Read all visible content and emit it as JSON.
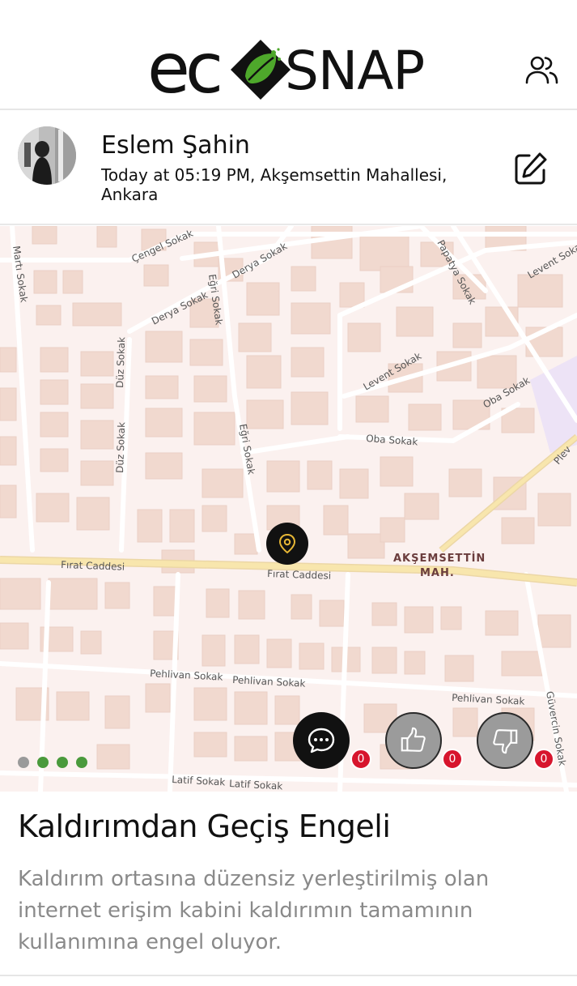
{
  "app": {
    "logo_left": "ec",
    "logo_right": "SNAP"
  },
  "header": {
    "people_icon": "users-icon"
  },
  "post": {
    "author": "Eslem Şahin",
    "meta": "Today at 05:19 PM, Akşemsettin Mahallesi, Ankara",
    "edit_icon": "edit-icon",
    "title": "Kaldırımdan Geçiş Engeli",
    "description": "Kaldırım ortasına düzensiz yerleştirilmiş olan internet erişim kabini kaldırımın tamamının kullanımına engel oluyor."
  },
  "map": {
    "streets": [
      "Çengel Sokak",
      "Derya Sokak",
      "Derya Sokak",
      "Eğri Sokak",
      "Papatya Sokak",
      "Levent Sokak",
      "Martı Sokak",
      "Düz Sokak",
      "Düz Sokak",
      "Eğri Sokak",
      "Levent Sokak",
      "Oba Sokak",
      "Oba Sokak",
      "Fırat Caddesi",
      "Fırat Caddesi",
      "Pehlivan Sokak",
      "Pehlivan Sokak",
      "Pehlivan Sokak",
      "Güvercin Sokak",
      "Latif Sokak",
      "Latif Sokak",
      "Plev"
    ],
    "district_line1": "AKŞEMSETTİN",
    "district_line2": "MAH.",
    "pin_icon": "location-pin-icon"
  },
  "carousel": {
    "count": 4,
    "active_index": 0
  },
  "actions": {
    "comment": {
      "icon": "comment-icon",
      "count": "0"
    },
    "like": {
      "icon": "thumbs-up-icon",
      "count": "0"
    },
    "dislike": {
      "icon": "thumbs-down-icon",
      "count": "0"
    }
  },
  "colors": {
    "brand_green": "#3c8c2b",
    "badge_red": "#d7152d",
    "map_bg": "#fbf1ef",
    "road_main": "#f6e2a8"
  }
}
